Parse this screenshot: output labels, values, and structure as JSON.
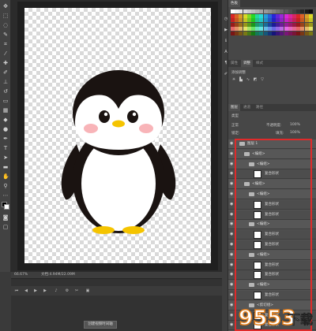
{
  "status": {
    "zoom": "66.67%",
    "doc_size": "文档:4.94M/22.09M"
  },
  "timeline": {
    "create_button": "创建视频时间轴"
  },
  "panels": {
    "swatches_tab": "色板",
    "adjust_tabs": [
      "属性",
      "调整",
      "样式"
    ],
    "adjust_heading": "添加调整",
    "layers_tabs": [
      "图层",
      "通道",
      "路径"
    ],
    "kind_filter": "类型",
    "blend_mode": "正常",
    "opacity_label": "不透明度:",
    "opacity_value": "100%",
    "lock_label": "锁定:",
    "fill_label": "填充:",
    "fill_value": "100%"
  },
  "layers": [
    {
      "name": "图层 1",
      "type": "group",
      "indent": 0
    },
    {
      "name": "<编组>",
      "type": "group",
      "indent": 1
    },
    {
      "name": "<编组>",
      "type": "group",
      "indent": 2
    },
    {
      "name": "复合形状",
      "type": "layer",
      "indent": 3
    },
    {
      "name": "<编组>",
      "type": "group",
      "indent": 1
    },
    {
      "name": "<编组>",
      "type": "group",
      "indent": 2
    },
    {
      "name": "复合形状",
      "type": "layer",
      "indent": 3
    },
    {
      "name": "复合形状",
      "type": "layer",
      "indent": 3
    },
    {
      "name": "<编组>",
      "type": "group",
      "indent": 2
    },
    {
      "name": "复合形状",
      "type": "layer",
      "indent": 3
    },
    {
      "name": "复合形状",
      "type": "layer",
      "indent": 3
    },
    {
      "name": "<编组>",
      "type": "group",
      "indent": 2
    },
    {
      "name": "复合形状",
      "type": "layer",
      "indent": 3
    },
    {
      "name": "复合形状",
      "type": "layer",
      "indent": 3
    },
    {
      "name": "<编组>",
      "type": "group",
      "indent": 2
    },
    {
      "name": "复合形状",
      "type": "layer",
      "indent": 3
    },
    {
      "name": "<剪切组>",
      "type": "group",
      "indent": 2
    },
    {
      "name": "复合形状",
      "type": "layer",
      "indent": 3
    },
    {
      "name": "复合形状",
      "type": "layer",
      "indent": 3
    }
  ],
  "watermark": {
    "number": "9553",
    "text": "下载"
  }
}
